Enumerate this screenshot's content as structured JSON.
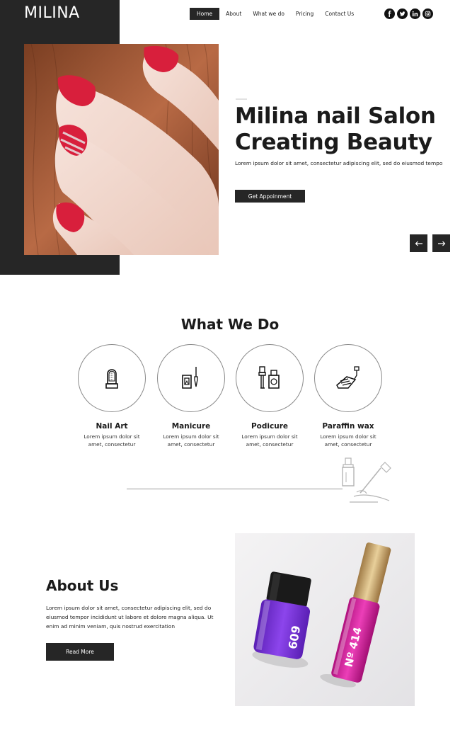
{
  "header": {
    "logo": "MILINA",
    "nav": [
      "Home",
      "About",
      "What we do",
      "Pricing",
      "Contact Us"
    ],
    "active_nav": "Home",
    "social": [
      {
        "icon": "facebook-icon",
        "glyph": "f"
      },
      {
        "icon": "twitter-icon",
        "glyph": "t"
      },
      {
        "icon": "linkedin-icon",
        "glyph": "in"
      },
      {
        "icon": "instagram-icon",
        "glyph": "ig"
      }
    ]
  },
  "hero": {
    "title_line1": "Milina nail Salon",
    "title_line2": "Creating Beauty",
    "text": "Lorem ipsum dolor sit amet, consectetur adipiscing elit, sed do eiusmod tempo",
    "button": "Get Appoinment",
    "prev_icon": "arrow-left-icon",
    "next_icon": "arrow-right-icon"
  },
  "what_we_do": {
    "title": "What We Do",
    "services": [
      {
        "name": "Nail Art",
        "desc": "Lorem ipsum dolor sit amet, consectetur",
        "icon": "nail-art-icon"
      },
      {
        "name": "Manicure",
        "desc": "Lorem ipsum dolor sit amet, consectetur",
        "icon": "manicure-icon"
      },
      {
        "name": "Podicure",
        "desc": "Lorem ipsum dolor sit amet, consectetur",
        "icon": "pedicure-icon"
      },
      {
        "name": "Paraffin wax",
        "desc": "Lorem ipsum dolor sit amet, consectetur",
        "icon": "paraffin-wax-icon"
      }
    ]
  },
  "about": {
    "title": "About Us",
    "text": "Lorem ipsum dolor sit amet, consectetur adipiscing elit, sed do eiusmod tempor incididunt ut labore et dolore magna aliqua. Ut enim ad minim veniam, quis nostrud exercitation",
    "button": "Read More",
    "bottle1_label": "609",
    "bottle2_label": "Nº 414"
  },
  "colors": {
    "dark": "#262626",
    "nail_red": "#d81f3c",
    "polish_purple": "#7b2fd8",
    "polish_pink": "#d61a9c",
    "cap_gold": "#c9a46a"
  }
}
